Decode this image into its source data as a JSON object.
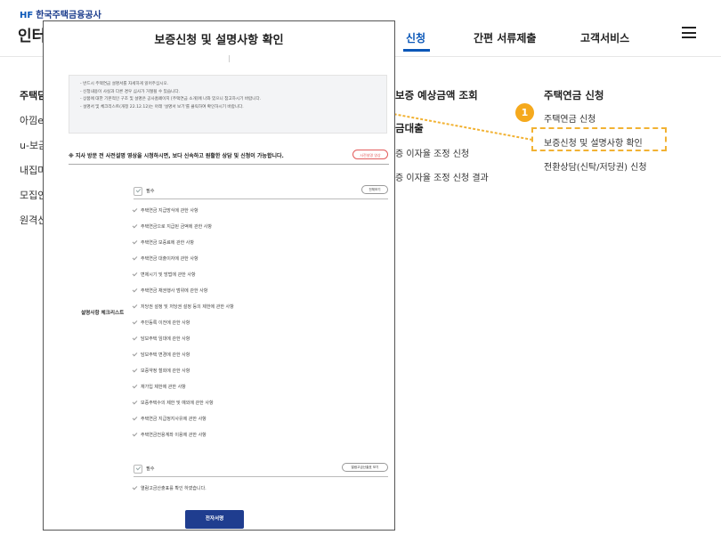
{
  "header": {
    "logo_mark": "HF",
    "logo_text": "한국주택금융공사",
    "site_title": "인터",
    "nav": [
      "신청",
      "간편 서류제출",
      "고객서비스"
    ],
    "active_nav": "신청"
  },
  "left_nav": {
    "heading": "주택담",
    "items": [
      "아낌e",
      "u-보금",
      "내집마",
      "모집인",
      "원격신"
    ]
  },
  "background_menu": {
    "middle": {
      "heading": "보증 예상금액 조회",
      "subheading": "금대출",
      "items": [
        "증 이자율 조정 신청",
        "증 이자율 조정 신청 결과"
      ]
    },
    "right": {
      "heading": "주택연금 신청",
      "items": [
        "주택연금 신청",
        "보증신청 및 설명사항 확인",
        "전환상담(신탁/저당권) 신청"
      ]
    }
  },
  "annotation": {
    "step": "1",
    "color": "#f5a91d"
  },
  "modal": {
    "title": "보증신청 및 설명사항 확인",
    "notice_lines": [
      "- 반드시 주택연금 설명서를 자세하게 읽어주십시오.",
      "- 신청내용이 사실과 다른 경우 심사가 거절될 수 있습니다.",
      "- 상품에 대한 기본적인 구조 및 설명은 공사홈페이지 [주택연금 소개]에 나와 있으니 참고하시기 바랍니다.",
      "- 설명서 및 체크리스트(개정 22.12.12)는 아래 '설명서 보기'를 클릭하여 확인하시기 바랍니다."
    ],
    "video_notice": "※ 지사 방문 전 사전설명 영상을 시청하시면, 보다 신속하고 원활한 상담 및 신청이 가능합니다.",
    "video_button": "사전설명 영상",
    "section_label": "설명사항 체크리스트",
    "required_label": "필수",
    "view_all_button": "전체보기",
    "checklist": [
      "주택연금 지급방식에 관한 사항",
      "주택연금으로 지급된 금액에 관한 사항",
      "주택연금 보증료에 관한 사항",
      "주택연금 대출이자에 관한 사항",
      "변제시기 및 방법에 관한 사항",
      "주택연금 채권행사 범위에 관한 사항",
      "저당권 설정 및 저당권 설정 등의 제한에 관한 사항",
      "주민등록 이전에 관한 사항",
      "담보주택 임대에 관한 사항",
      "담보주택 변경에 관한 사항",
      "보증약정 철회에 관한 사항",
      "재가입 제한에 관한 사항",
      "보증주택수의 제한 및 예외에 관한 사항",
      "주택연금 지급정지사유에 관한 사항",
      "주택연금전용계좌 이용에 관한 사항"
    ],
    "required_label_2": "필수",
    "view_button_2": "열람고금산출표 보기",
    "checklist_2": [
      "열람고금산출표를 확인 하였습니다."
    ],
    "sign_button": "전자서명"
  }
}
